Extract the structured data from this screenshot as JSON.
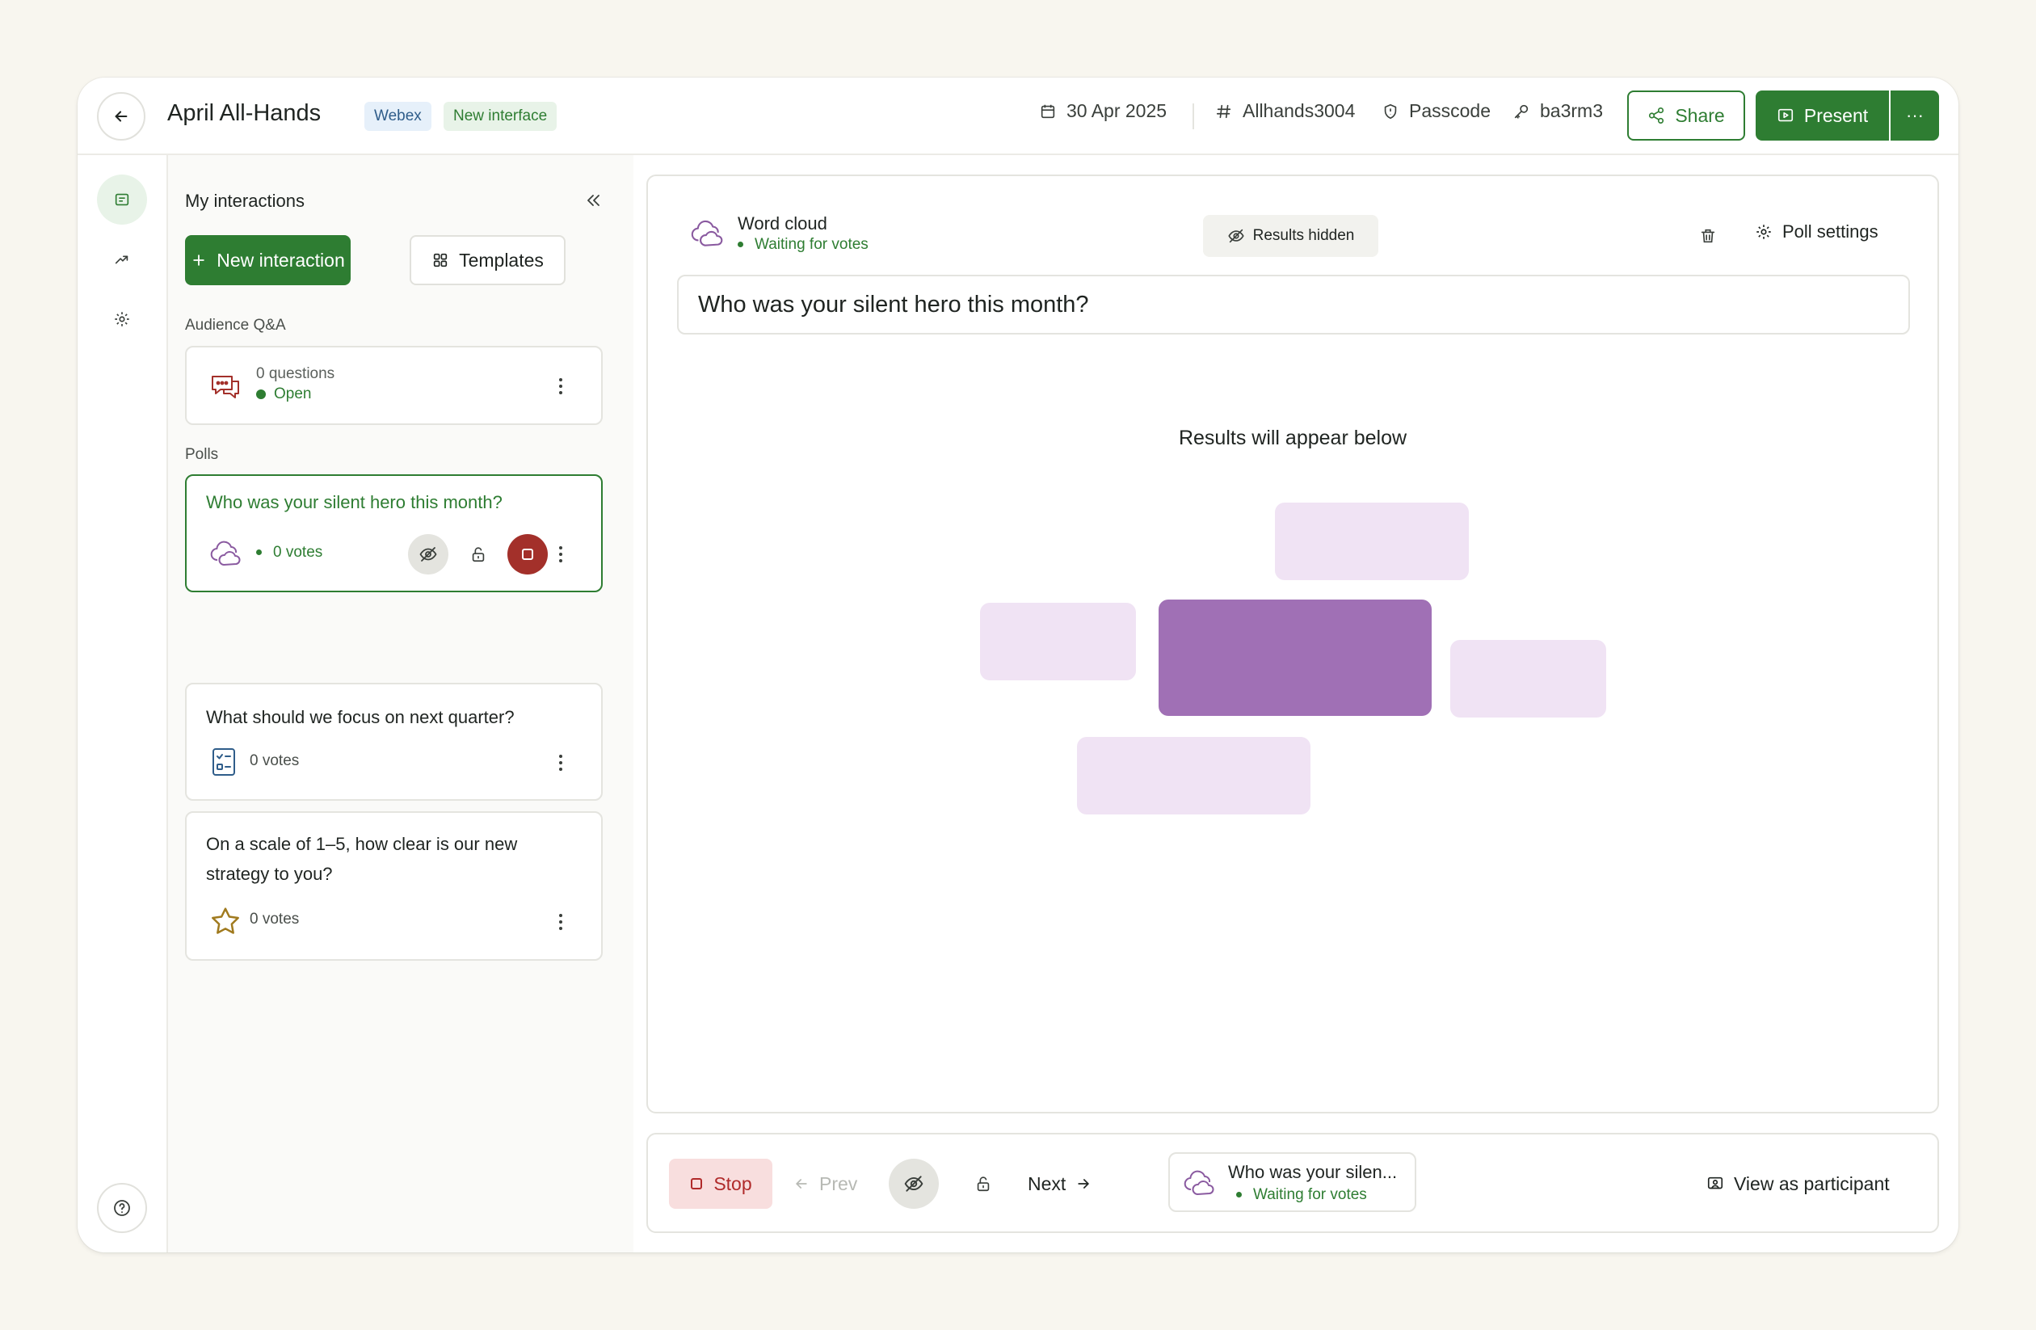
{
  "header": {
    "title": "April All-Hands",
    "badges": [
      "Webex",
      "New interface"
    ],
    "date": "30 Apr 2025",
    "event_code": "Allhands3004",
    "passcode_label": "Passcode",
    "passcode_value": "ba3rm3",
    "share_label": "Share",
    "present_label": "Present",
    "more_label": "···"
  },
  "panel": {
    "title": "My interactions",
    "new_label": "New interaction",
    "templates_label": "Templates",
    "qa_section": "Audience Q&A",
    "qa_card": {
      "count": "0 questions",
      "status": "Open"
    },
    "polls_section": "Polls",
    "polls": [
      {
        "question": "Who was your silent hero this month?",
        "votes": "0 votes",
        "icon": "word-cloud-icon",
        "active": true
      },
      {
        "question": "What should we focus on next quarter?",
        "votes": "0 votes",
        "icon": "checklist-icon",
        "active": false
      },
      {
        "question": "On a scale of 1–5, how clear is our new strategy to you?",
        "votes": "0 votes",
        "icon": "star-icon",
        "active": false
      }
    ]
  },
  "main": {
    "poll_type": "Word cloud",
    "poll_status": "Waiting for votes",
    "results_hidden_label": "Results hidden",
    "poll_settings_label": "Poll settings",
    "question": "Who was your silent hero this month?",
    "results_note": "Results will appear below"
  },
  "bottom": {
    "stop_label": "Stop",
    "prev_label": "Prev",
    "next_label": "Next",
    "current_title": "Who was your silen...",
    "current_status": "Waiting for votes",
    "participant_label": "View as participant"
  },
  "colors": {
    "brand_green": "#2e7d32",
    "stop_red": "#a3302a",
    "word_cloud_purple": "#a070b5",
    "word_cloud_light": "#f0e3f4",
    "page_bg": "#f8f6ef"
  }
}
